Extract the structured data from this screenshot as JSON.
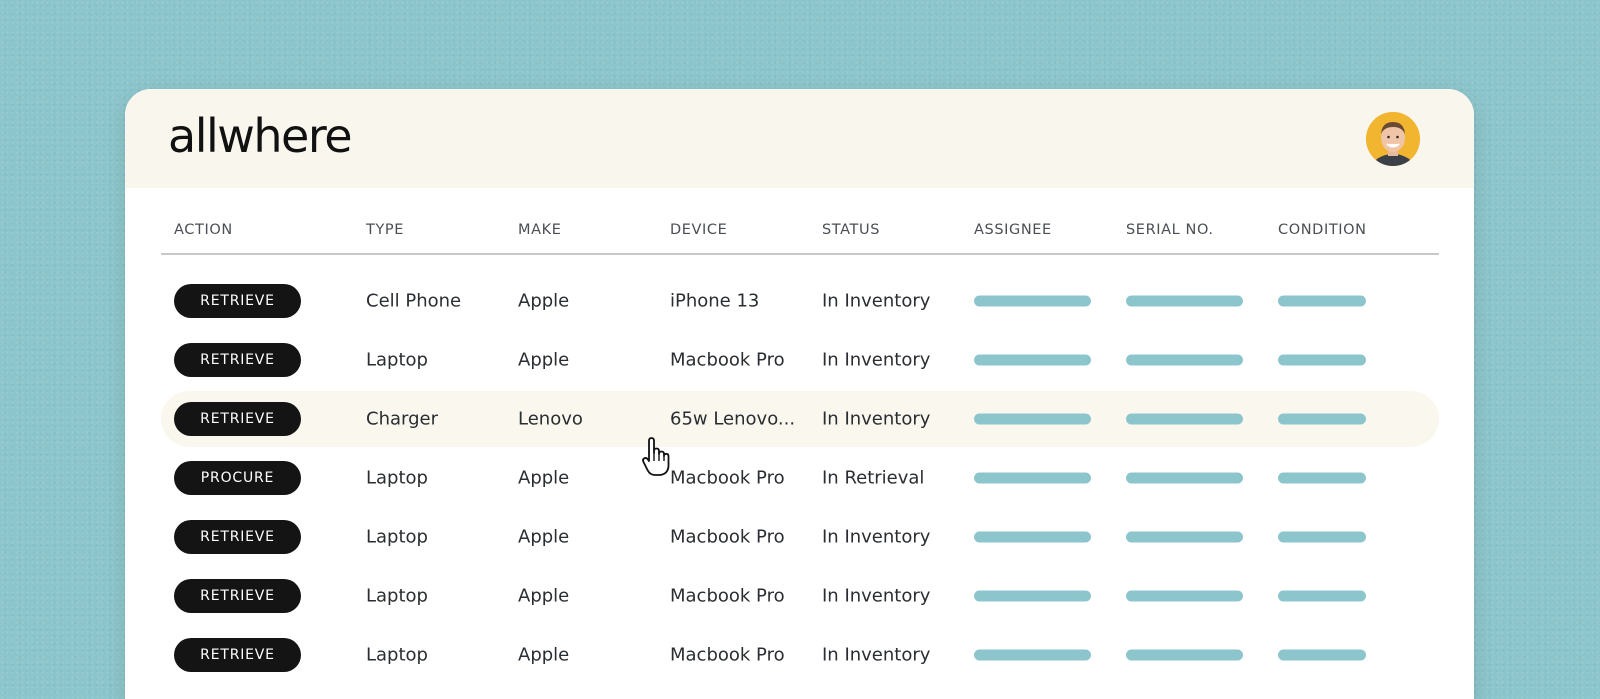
{
  "brand": {
    "logo_text": "allwhere"
  },
  "user": {
    "avatar_icon": "user-avatar-photo"
  },
  "colors": {
    "background": "#8cc6cc",
    "header": "#f9f6ee",
    "pill": "#141414",
    "placeholder_bar": "#8cc6cc",
    "hover_row": "#faf7ee"
  },
  "table": {
    "columns": [
      "ACTION",
      "TYPE",
      "MAKE",
      "DEVICE",
      "STATUS",
      "ASSIGNEE",
      "SERIAL NO.",
      "CONDITION"
    ],
    "rows": [
      {
        "action": "RETRIEVE",
        "type": "Cell Phone",
        "make": "Apple",
        "device": "iPhone 13",
        "status": "In Inventory"
      },
      {
        "action": "RETRIEVE",
        "type": "Laptop",
        "make": "Apple",
        "device": "Macbook Pro",
        "status": "In Inventory"
      },
      {
        "action": "RETRIEVE",
        "type": "Charger",
        "make": "Lenovo",
        "device": "65w Lenovo...",
        "status": "In Inventory"
      },
      {
        "action": "PROCURE",
        "type": "Laptop",
        "make": "Apple",
        "device": "Macbook Pro",
        "status": "In Retrieval"
      },
      {
        "action": "RETRIEVE",
        "type": "Laptop",
        "make": "Apple",
        "device": "Macbook Pro",
        "status": "In Inventory"
      },
      {
        "action": "RETRIEVE",
        "type": "Laptop",
        "make": "Apple",
        "device": "Macbook Pro",
        "status": "In Inventory"
      },
      {
        "action": "RETRIEVE",
        "type": "Laptop",
        "make": "Apple",
        "device": "Macbook Pro",
        "status": "In Inventory"
      }
    ]
  },
  "cursor_icon": "pointer-hand-icon"
}
